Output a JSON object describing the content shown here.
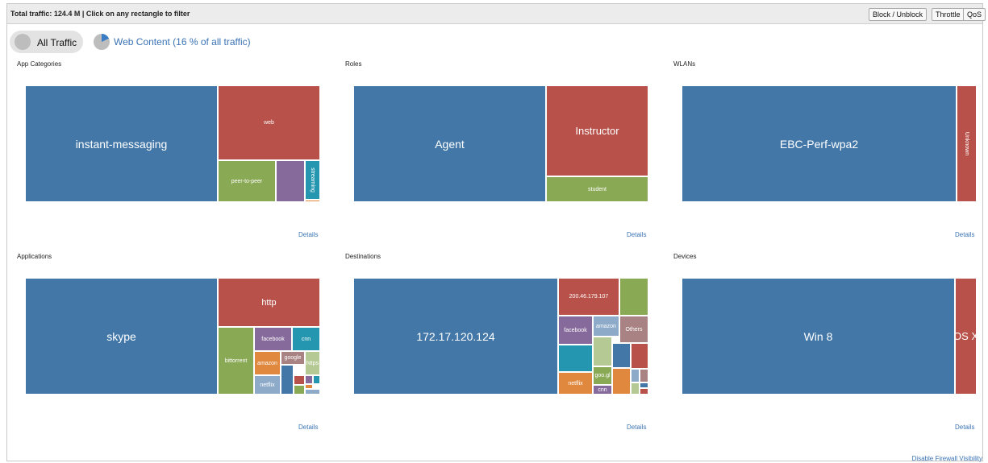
{
  "header": {
    "title": "Total traffic: 124.4 M | Click on any rectangle to filter",
    "buttons": [
      "Block / Unblock",
      "Throttle",
      "QoS"
    ]
  },
  "filters": {
    "all_traffic": "All Traffic",
    "web_content": "Web Content (16 % of all traffic)"
  },
  "colors": {
    "blue": "#4277a8",
    "red": "#b85149",
    "green": "#8aa955",
    "purple": "#866a9b",
    "teal": "#2596af",
    "orange": "#e0883d",
    "light_green": "#b4c993",
    "pink_gray": "#a98383",
    "light_blue": "#8daac9",
    "accent_link": "#3a73b5"
  },
  "panels": [
    {
      "title": "App Categories",
      "cells": [
        {
          "label": "instant-messaging",
          "color": "blue",
          "size": "big"
        },
        {
          "label": "web",
          "color": "red"
        },
        {
          "label": "peer-to-peer",
          "color": "green"
        },
        {
          "label": "",
          "color": "purple"
        },
        {
          "label": "streaming",
          "color": "teal",
          "vertical": true
        },
        {
          "label": "",
          "color": "orange"
        }
      ],
      "details": "Details"
    },
    {
      "title": "Roles",
      "cells": [
        {
          "label": "Agent",
          "color": "blue",
          "size": "big"
        },
        {
          "label": "Instructor",
          "color": "red",
          "size": "mid"
        },
        {
          "label": "student",
          "color": "green"
        }
      ],
      "details": "Details"
    },
    {
      "title": "WLANs",
      "cells": [
        {
          "label": "EBC-Perf-wpa2",
          "color": "blue",
          "size": "big"
        },
        {
          "label": "Unknown",
          "color": "red",
          "vertical": true
        }
      ],
      "details": "Details"
    },
    {
      "title": "Applications",
      "cells": [
        {
          "label": "skype",
          "color": "blue",
          "size": "big"
        },
        {
          "label": "http",
          "color": "red",
          "size": "mid"
        },
        {
          "label": "bittorrent",
          "color": "green"
        },
        {
          "label": "facebook",
          "color": "purple"
        },
        {
          "label": "cnn",
          "color": "teal"
        },
        {
          "label": "amazon",
          "color": "orange"
        },
        {
          "label": "google",
          "color": "pink_gray"
        },
        {
          "label": "https",
          "color": "light_green"
        },
        {
          "label": "netflix",
          "color": "light_blue"
        },
        {
          "label": "",
          "color": "blue"
        },
        {
          "label": "",
          "color": "red"
        },
        {
          "label": "",
          "color": "purple"
        },
        {
          "label": "",
          "color": "green"
        },
        {
          "label": "",
          "color": "teal"
        },
        {
          "label": "",
          "color": "orange"
        },
        {
          "label": "",
          "color": "light_blue"
        }
      ],
      "details": "Details"
    },
    {
      "title": "Destinations",
      "cells": [
        {
          "label": "172.17.120.124",
          "color": "blue",
          "size": "big"
        },
        {
          "label": "200.46.179.107",
          "color": "red"
        },
        {
          "label": "",
          "color": "green"
        },
        {
          "label": "facebook",
          "color": "purple"
        },
        {
          "label": "amazon",
          "color": "light_blue"
        },
        {
          "label": "Others",
          "color": "pink_gray"
        },
        {
          "label": "",
          "color": "teal"
        },
        {
          "label": "",
          "color": "light_green"
        },
        {
          "label": "",
          "color": "blue"
        },
        {
          "label": "",
          "color": "red"
        },
        {
          "label": "goo.gl",
          "color": "green"
        },
        {
          "label": "",
          "color": "light_blue"
        },
        {
          "label": "",
          "color": "pink_gray"
        },
        {
          "label": "netflix",
          "color": "orange"
        },
        {
          "label": "cnn",
          "color": "purple"
        },
        {
          "label": "",
          "color": "orange"
        },
        {
          "label": "",
          "color": "light_green"
        },
        {
          "label": "",
          "color": "blue"
        },
        {
          "label": "",
          "color": "red"
        }
      ],
      "details": "Details"
    },
    {
      "title": "Devices",
      "cells": [
        {
          "label": "Win 8",
          "color": "blue",
          "size": "big"
        },
        {
          "label": "OS X",
          "color": "red",
          "size": "mid"
        }
      ],
      "details": "Details"
    }
  ],
  "footer": {
    "firewall_link": "Disable Firewall Visibility"
  }
}
